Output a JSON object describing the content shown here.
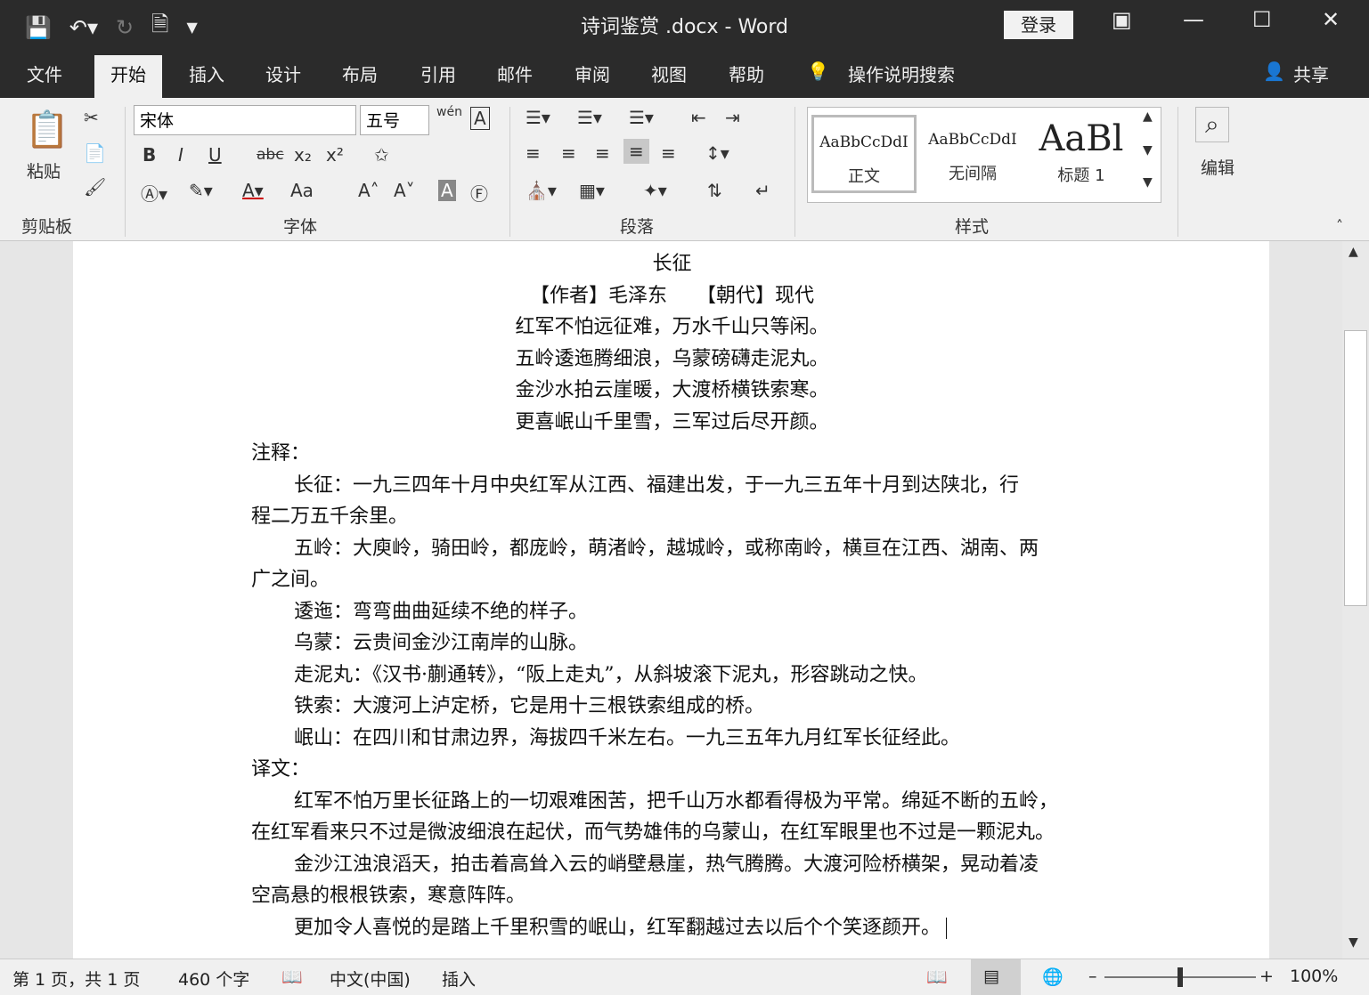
{
  "window": {
    "title": "诗词鉴赏 .docx - Word",
    "login": "登录"
  },
  "tabs": [
    "文件",
    "开始",
    "插入",
    "设计",
    "布局",
    "引用",
    "邮件",
    "审阅",
    "视图",
    "帮助"
  ],
  "tell_me": "操作说明搜索",
  "share": "共享",
  "ribbon": {
    "clipboard": {
      "paste": "粘贴",
      "label": "剪贴板"
    },
    "font": {
      "name": "宋体",
      "size": "五号",
      "label": "字体",
      "bold": "B",
      "italic": "I",
      "underline": "U",
      "strike": "abc",
      "sub": "x₂",
      "sup": "x²",
      "case": "Aa",
      "phonetic": "wén"
    },
    "paragraph": {
      "label": "段落"
    },
    "styles": {
      "label": "样式",
      "items": [
        {
          "preview": "AaBbCcDdI",
          "name": "正文"
        },
        {
          "preview": "AaBbCcDdI",
          "name": "无间隔"
        },
        {
          "preview": "AaBl",
          "name": "标题 1"
        }
      ]
    },
    "editing": {
      "label": "编辑"
    }
  },
  "document": {
    "title": "长征",
    "byline": "【作者】毛泽东　　【朝代】现代",
    "poem": [
      "红军不怕远征难，万水千山只等闲。",
      "五岭逶迤腾细浪，乌蒙磅礴走泥丸。",
      "金沙水拍云崖暖，大渡桥横铁索寒。",
      "更喜岷山千里雪，三军过后尽开颜。"
    ],
    "notes_heading": "注释：",
    "notes": [
      "长征：一九三四年十月中央红军从江西、福建出发，于一九三五年十月到达陕北，行",
      "程二万五千余里。",
      "五岭：大庾岭，骑田岭，都庞岭，萌渚岭，越城岭，或称南岭，横亘在江西、湖南、两",
      "广之间。",
      "逶迤：弯弯曲曲延续不绝的样子。",
      "乌蒙：云贵间金沙江南岸的山脉。",
      "走泥丸：《汉书·蒯通转》，“阪上走丸”，从斜坡滚下泥丸，形容跳动之快。",
      "铁索：大渡河上泸定桥，它是用十三根铁索组成的桥。",
      "岷山：在四川和甘肃边界，海拔四千米左右。一九三五年九月红军长征经此。"
    ],
    "translation_heading": "译文：",
    "translation": [
      "红军不怕万里长征路上的一切艰难困苦，把千山万水都看得极为平常。绵延不断的五岭，",
      "在红军看来只不过是微波细浪在起伏，而气势雄伟的乌蒙山，在红军眼里也不过是一颗泥丸。",
      "金沙江浊浪滔天，拍击着高耸入云的峭壁悬崖，热气腾腾。大渡河险桥横架，晃动着凌",
      "空高悬的根根铁索，寒意阵阵。",
      "更加令人喜悦的是踏上千里积雪的岷山，红军翻越过去以后个个笑逐颜开。"
    ]
  },
  "status": {
    "page": "第 1 页，共 1 页",
    "words": "460 个字",
    "language": "中文(中国)",
    "mode": "插入",
    "zoom": "100%",
    "zoom_percent": 100
  }
}
